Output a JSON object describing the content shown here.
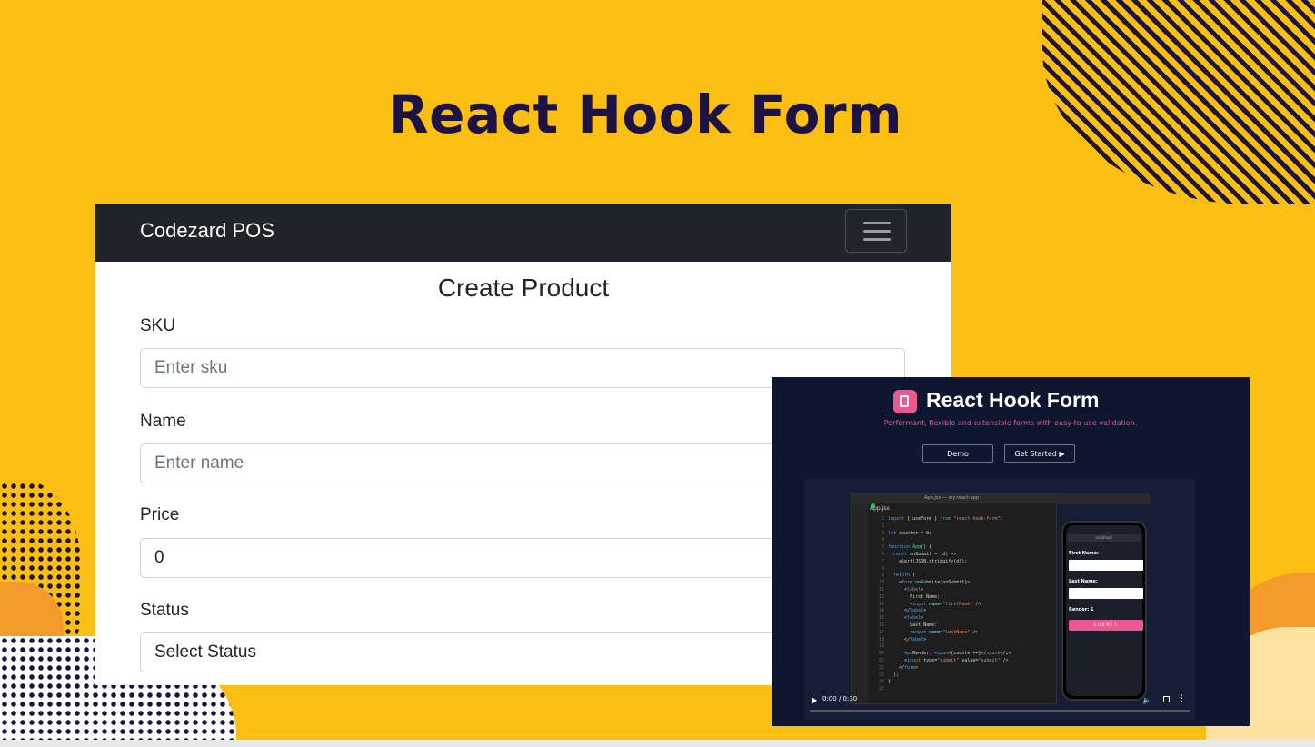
{
  "slide": {
    "title": "React Hook Form"
  },
  "app": {
    "brand": "Codezard POS",
    "menu_icon": "hamburger-icon",
    "form_title": "Create Product",
    "fields": {
      "sku": {
        "label": "SKU",
        "placeholder": "Enter sku",
        "value": ""
      },
      "name": {
        "label": "Name",
        "placeholder": "Enter name",
        "value": ""
      },
      "price": {
        "label": "Price",
        "value": "0"
      },
      "status": {
        "label": "Status",
        "selected": "Select Status"
      }
    }
  },
  "video": {
    "logo_icon": "clipboard-icon",
    "title": "React Hook Form",
    "subtitle": "Performant, flexible and extensible forms with easy-to-use validation.",
    "demo_label": "Demo",
    "get_started_label": "Get Started ▶",
    "editor_window_title": "App.jsx — my-react-app",
    "editor_tab": "App.jsx",
    "phone": {
      "url": "localhost",
      "first_name_label": "First Name:",
      "last_name_label": "Last Name:",
      "render_text": "Render: 1",
      "submit_label": "SUBMIT"
    },
    "time": "0:00 / 0:30",
    "progress": 0
  },
  "colors": {
    "background": "#fbbf14",
    "title": "#1c1344",
    "navbar": "#212529",
    "accent_pink": "#ec5990"
  }
}
